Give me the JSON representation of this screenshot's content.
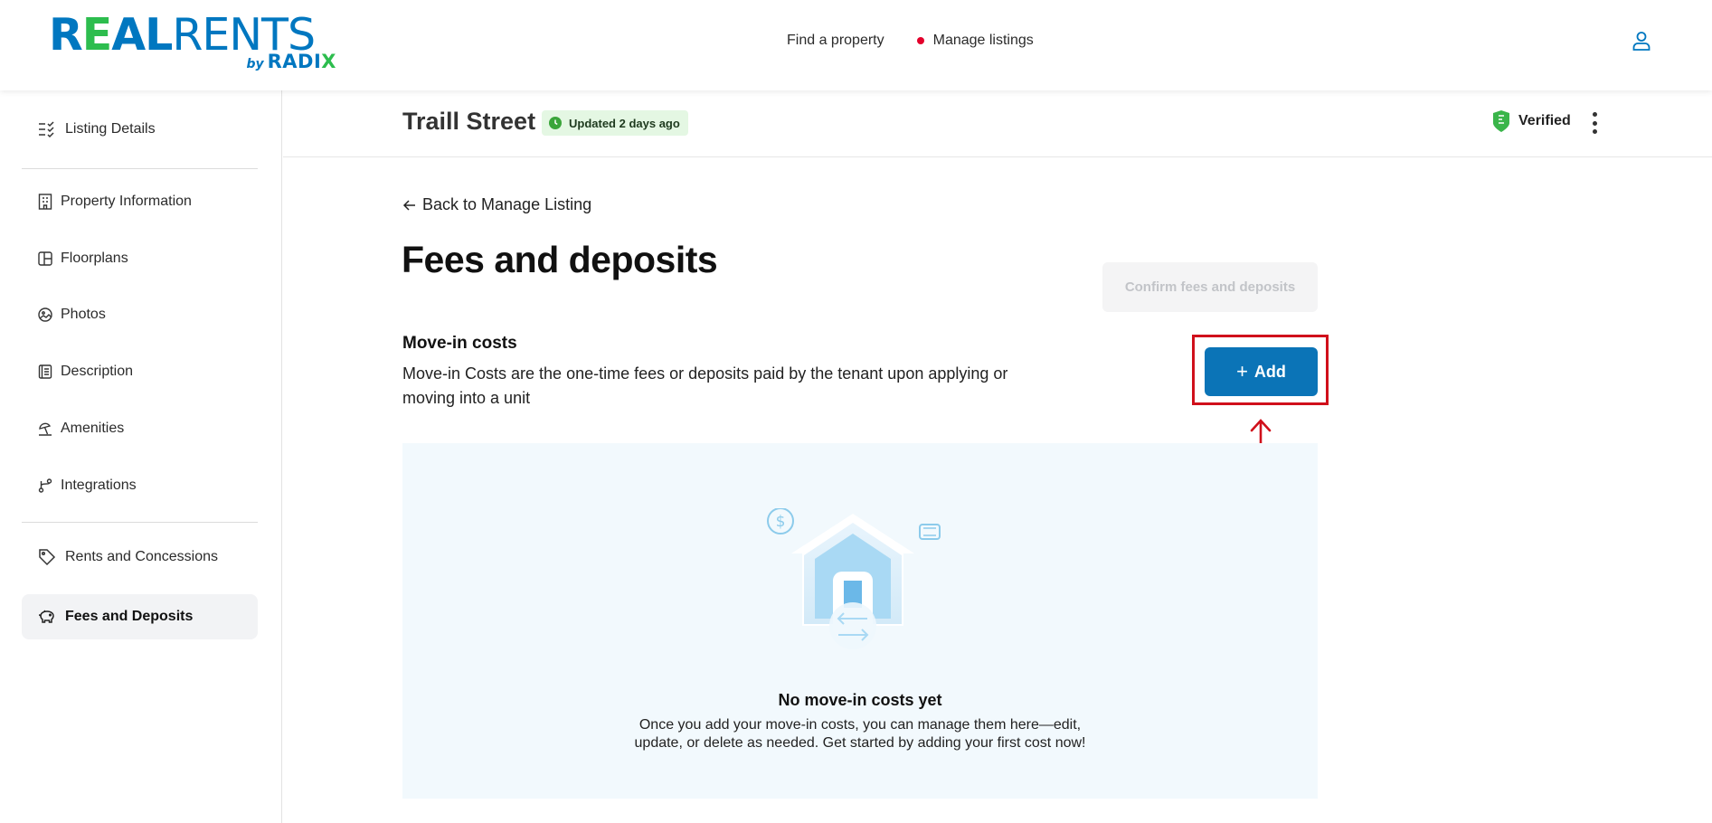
{
  "brand": {
    "name_part1": "R",
    "name_e": "E",
    "name_part2": "AL",
    "name_part3": "RENTS",
    "by": "by",
    "sub": "RADI",
    "sub_x": "X",
    "colors": {
      "blue": "#0077c0",
      "green": "#2dbd4e"
    }
  },
  "header": {
    "nav": [
      {
        "label": "Find a property"
      },
      {
        "label": "Manage listings",
        "indicator_color": "#e3002b"
      }
    ],
    "user_icon": "user-icon"
  },
  "sidebar": {
    "items": [
      {
        "label": "Listing Details",
        "icon": "checklist-icon"
      },
      {
        "label": "Property Information",
        "icon": "building-icon"
      },
      {
        "label": "Floorplans",
        "icon": "floorplan-icon"
      },
      {
        "label": "Photos",
        "icon": "photo-icon"
      },
      {
        "label": "Description",
        "icon": "document-icon"
      },
      {
        "label": "Amenities",
        "icon": "beach-umbrella-icon"
      },
      {
        "label": "Integrations",
        "icon": "integration-icon"
      },
      {
        "label": "Rents and Concessions",
        "icon": "tag-icon"
      },
      {
        "label": "Fees and Deposits",
        "icon": "piggy-bank-icon",
        "active": true
      }
    ]
  },
  "listing": {
    "title": "Traill Street",
    "updated_badge": "Updated 2 days ago",
    "verified_label": "Verified"
  },
  "main": {
    "back_link": "Back to Manage Listing",
    "page_title": "Fees and deposits",
    "confirm_button": "Confirm fees and deposits",
    "section": {
      "title": "Move-in costs",
      "description": "Move-in Costs are the one-time fees or deposits paid by the tenant upon applying or moving into a unit",
      "add_button": "Add"
    },
    "empty_state": {
      "title": "No move-in costs yet",
      "description_line1": "Once you add your move-in costs, you can manage them here—edit,",
      "description_line2": "update, or delete as needed. Get started by adding your first cost now!"
    }
  },
  "colors": {
    "accent": "#0b74b7",
    "annotation": "#d0101b",
    "panel_bg": "#f2f9fd",
    "badge_bg": "#e4f7e3"
  }
}
